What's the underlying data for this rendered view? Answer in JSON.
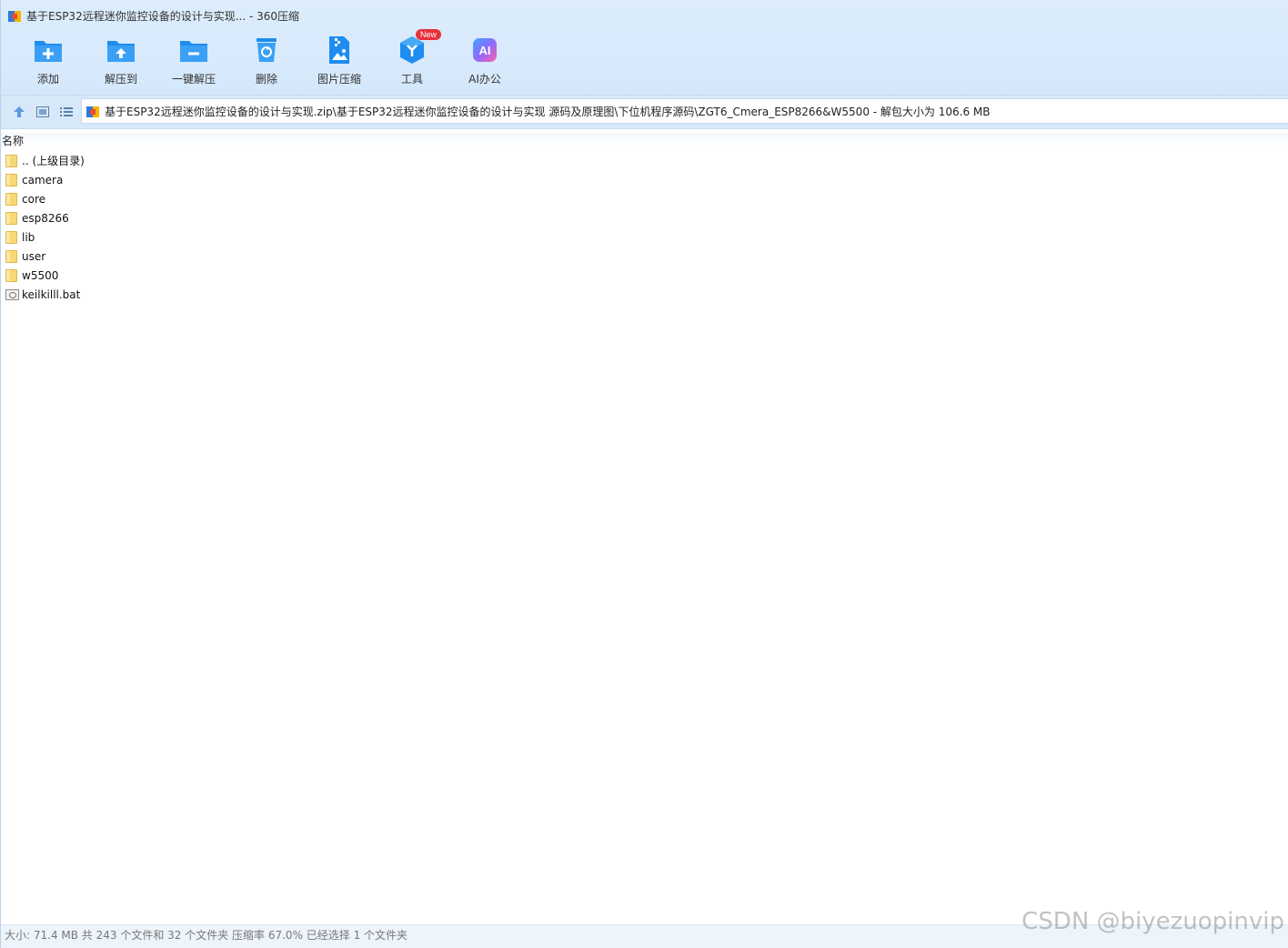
{
  "window": {
    "title": "基于ESP32远程迷你监控设备的设计与实现... - 360压缩"
  },
  "toolbar": {
    "items": [
      {
        "label": "添加",
        "icon": "add-folder-icon"
      },
      {
        "label": "解压到",
        "icon": "extract-to-icon"
      },
      {
        "label": "一键解压",
        "icon": "one-click-extract-icon"
      },
      {
        "label": "删除",
        "icon": "recycle-bin-icon"
      },
      {
        "label": "图片压缩",
        "icon": "image-compress-icon"
      },
      {
        "label": "工具",
        "icon": "tools-icon",
        "badge": "New"
      },
      {
        "label": "AI办公",
        "icon": "ai-office-icon",
        "icon_text": "AI"
      }
    ]
  },
  "address": {
    "path": "基于ESP32远程迷你监控设备的设计与实现.zip\\基于ESP32远程迷你监控设备的设计与实现 源码及原理图\\下位机程序源码\\ZGT6_Cmera_ESP8266&W5500 - 解包大小为 106.6 MB"
  },
  "list": {
    "column_name": "名称",
    "items": [
      {
        "name": ".. (上级目录)",
        "type": "folder"
      },
      {
        "name": "camera",
        "type": "folder"
      },
      {
        "name": "core",
        "type": "folder"
      },
      {
        "name": "esp8266",
        "type": "folder"
      },
      {
        "name": "lib",
        "type": "folder"
      },
      {
        "name": "user",
        "type": "folder"
      },
      {
        "name": "w5500",
        "type": "folder"
      },
      {
        "name": "keilkilll.bat",
        "type": "bat"
      }
    ]
  },
  "status": {
    "text": "大小: 71.4 MB 共 243 个文件和 32 个文件夹 压缩率 67.0% 已经选择 1 个文件夹"
  },
  "watermark": "CSDN @biyezuopinvip",
  "colors": {
    "accent": "#1e8cf0",
    "toolbar_bg": "#d9eafb",
    "folder": "#f8d775",
    "badge": "#e8313a"
  }
}
